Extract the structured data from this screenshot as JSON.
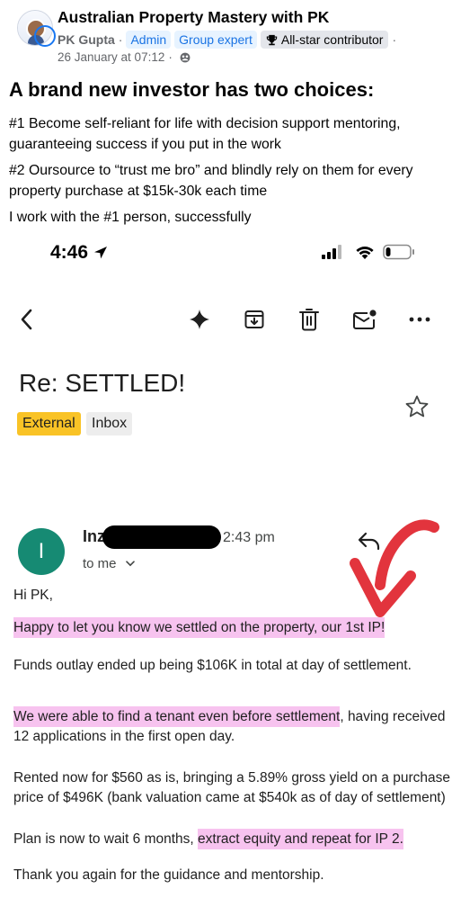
{
  "post": {
    "group_name": "Australian Property Mastery with PK",
    "author": "PK Gupta",
    "badges": [
      "Admin",
      "Group expert"
    ],
    "contributor_badge": "All-star contributor",
    "date": "26 January at 07:12",
    "title": "A brand new investor has two choices:",
    "paragraphs": [
      "#1 Become self-reliant for life with decision support mentoring, guaranteeing success if you put in the work",
      "#2 Oursource to “trust me bro” and blindly rely on them for every property purchase at $15k-30k each time",
      "I work with the #1 person, successfully"
    ],
    "icons": {
      "avatar": "group-avatar-icon",
      "trophy": "trophy-icon",
      "audience": "group-audience-icon"
    },
    "colors": {
      "badge_blue": "#1b74e4",
      "badge_bg": "#e7f3ff",
      "text": "#050505",
      "muted": "#65676b"
    }
  },
  "screenshot": {
    "status_bar": {
      "time": "4:46",
      "battery_level": 0.2
    },
    "toolbar": {
      "icons": [
        "back-arrow-icon",
        "gemini-sparkle-icon",
        "archive-icon",
        "trash-icon",
        "mark-unread-icon",
        "more-icon"
      ]
    },
    "email": {
      "subject": "Re: SETTLED!",
      "labels": [
        "External",
        "Inbox"
      ],
      "sender_initial": "I",
      "sender_name": "Inz",
      "time": "2:43 pm",
      "recipient": "to me",
      "greeting": "Hi PK,",
      "body": [
        {
          "highlight": "Happy to let you know we settled on the property, our 1st IP!",
          "text": ""
        },
        {
          "highlight": "",
          "text": "Funds outlay ended up being $106K in total at day of settlement."
        },
        {
          "highlight": "We were able to find a tenant even before settlement",
          "text": ", having received 12 applications in the first open day."
        },
        {
          "highlight": "",
          "text": "Rented now for $560 as is, bringing a 5.89% gross yield on a purchase price of $496K (bank valuation came at $540k as of day of settlement)"
        },
        {
          "prefix": "Plan is now to wait 6 months, ",
          "highlight": "extract equity and repeat for IP 2."
        },
        {
          "highlight": "",
          "text": "Thank you again for the guidance and mentorship."
        }
      ]
    },
    "colors": {
      "external_label": "#f9c326",
      "inbox_label": "#ededed",
      "sender_avatar": "#168a73",
      "highlight": "#f7c3ef",
      "annotation_arrow": "#e2343d"
    }
  }
}
